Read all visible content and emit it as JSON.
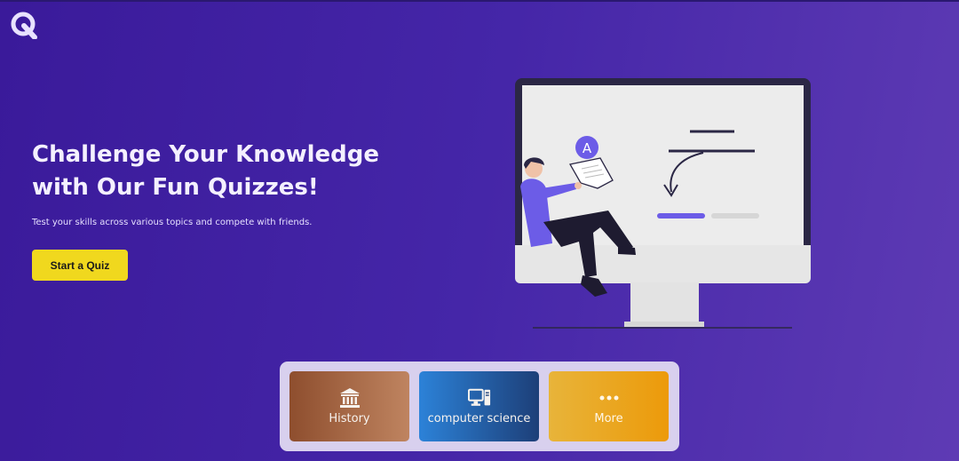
{
  "header": {
    "logo_icon": "quiz-q-logo-icon"
  },
  "hero": {
    "title_line1": "Challenge Your Knowledge",
    "title_line2": "with Our Fun Quizzes!",
    "subtitle": "Test your skills across various topics and compete with friends.",
    "cta_label": "Start a Quiz",
    "illustration_badge": "A"
  },
  "categories": [
    {
      "label": "History",
      "icon": "museum-icon"
    },
    {
      "label": "computer science",
      "icon": "desktop-computer-icon"
    },
    {
      "label": "More",
      "icon": "ellipsis-icon"
    }
  ],
  "colors": {
    "background_start": "#3a1a9a",
    "background_end": "#5e3bb4",
    "cta": "#f0d81e",
    "accent": "#6c5ce7"
  }
}
